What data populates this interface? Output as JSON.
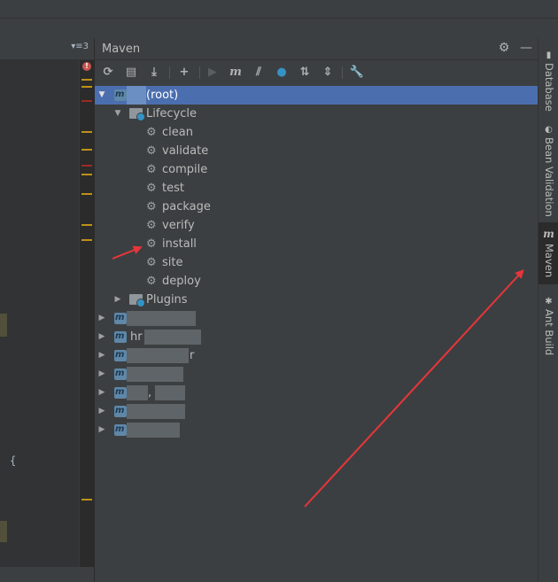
{
  "panel": {
    "title": "Maven",
    "header_icons": [
      "gear-icon",
      "minimize-icon"
    ]
  },
  "toolbar": {
    "icons": [
      "reload-icon",
      "generate-sources-icon",
      "download-icon",
      "add-icon",
      "run-icon",
      "maven-goal-icon",
      "toggle-offline-icon",
      "skip-tests-icon",
      "show-dependencies-icon",
      "collapse-all-icon",
      "settings-wrench-icon"
    ]
  },
  "tree": {
    "root_label": "(root)",
    "lifecycle_label": "Lifecycle",
    "lifecycle_goals": [
      "clean",
      "validate",
      "compile",
      "test",
      "package",
      "verify",
      "install",
      "site",
      "deploy"
    ],
    "plugins_label": "Plugins",
    "partial_module_fragments": [
      "hr",
      "r",
      ","
    ]
  },
  "editor": {
    "tab_menu": "▾≡3",
    "error_badge": "!",
    "brace": "{"
  },
  "right_strip": {
    "tabs": [
      {
        "label": "Database",
        "icon": "database-icon"
      },
      {
        "label": "Bean Validation",
        "icon": "bean-validation-icon"
      },
      {
        "label": "Maven",
        "icon": "maven-icon",
        "active": true
      },
      {
        "label": "Ant Build",
        "icon": "ant-icon"
      }
    ]
  },
  "colors": {
    "selection": "#4b6eaf",
    "panel_bg": "#3c3f41",
    "editor_bg": "#2b2b2b",
    "annotation_arrow": "#e8353a"
  }
}
